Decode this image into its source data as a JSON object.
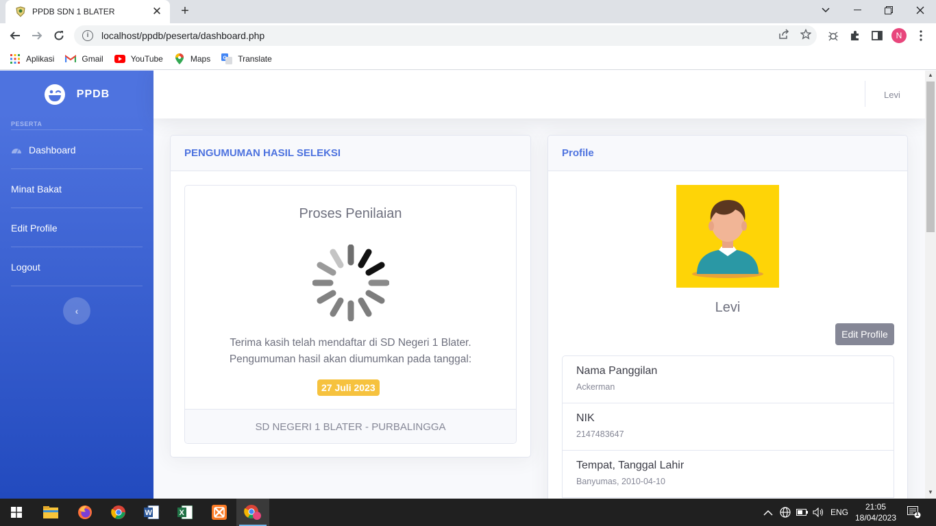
{
  "browser": {
    "tab_title": "PPDB SDN 1 BLATER",
    "tab_close": "✕",
    "new_tab": "+",
    "url": "localhost/ppdb/peserta/dashboard.php",
    "profile_initial": "N",
    "bookmarks": [
      {
        "label": "Aplikasi",
        "icon": "apps-grid-icon"
      },
      {
        "label": "Gmail",
        "icon": "gmail-icon"
      },
      {
        "label": "YouTube",
        "icon": "youtube-icon"
      },
      {
        "label": "Maps",
        "icon": "maps-icon"
      },
      {
        "label": "Translate",
        "icon": "translate-icon"
      }
    ]
  },
  "sidebar": {
    "brand": "PPDB",
    "heading": "PESERTA",
    "items": [
      {
        "label": "Dashboard"
      },
      {
        "label": "Minat Bakat"
      },
      {
        "label": "Edit Profile"
      },
      {
        "label": "Logout"
      }
    ],
    "toggle": "‹"
  },
  "topbar": {
    "username": "Levi"
  },
  "announcement": {
    "header": "PENGUMUMAN HASIL SELEKSI",
    "status_title": "Proses Penilaian",
    "message_line1": "Terima kasih telah mendaftar di SD Negeri 1 Blater.",
    "message_line2": "Pengumuman hasil akan diumumkan pada tanggal:",
    "date": "27 Juli 2023",
    "footer": "SD NEGERI 1 BLATER - PURBALINGGA"
  },
  "profile": {
    "header": "Profile",
    "name": "Levi",
    "edit_button": "Edit Profile",
    "fields": [
      {
        "label": "Nama Panggilan",
        "value": "Ackerman"
      },
      {
        "label": "NIK",
        "value": "2147483647"
      },
      {
        "label": "Tempat, Tanggal Lahir",
        "value": "Banyumas, 2010-04-10"
      }
    ]
  },
  "taskbar": {
    "language": "ENG",
    "time": "21:05",
    "date": "18/04/2023",
    "notification_count": "1"
  },
  "colors": {
    "primary": "#4e73df",
    "warning": "#f6c23e",
    "secondary": "#858796"
  }
}
